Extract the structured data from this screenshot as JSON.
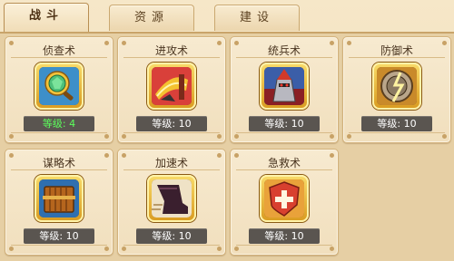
{
  "tabs": [
    {
      "label": "战斗",
      "active": true
    },
    {
      "label": "资源",
      "active": false
    },
    {
      "label": "建设",
      "active": false
    }
  ],
  "skills": [
    {
      "name": "侦查术",
      "level": "等级: 4",
      "icon": "magnifier-icon",
      "highlight": true
    },
    {
      "name": "进攻术",
      "level": "等级: 10",
      "icon": "attack-helmet-icon",
      "highlight": false
    },
    {
      "name": "统兵术",
      "level": "等级: 10",
      "icon": "commander-icon",
      "highlight": false
    },
    {
      "name": "防御术",
      "level": "等级: 10",
      "icon": "shield-icon",
      "highlight": false
    },
    {
      "name": "谋略术",
      "level": "等级: 10",
      "icon": "scroll-book-icon",
      "highlight": false
    },
    {
      "name": "加速术",
      "level": "等级: 10",
      "icon": "speed-boot-icon",
      "highlight": false
    },
    {
      "name": "急救术",
      "level": "等级: 10",
      "icon": "first-aid-icon",
      "highlight": false
    }
  ],
  "colors": {
    "level_normal": "#ffffff",
    "level_highlight": "#5cff5c",
    "background": "#f3e2bf",
    "card_border": "#d3b27c"
  }
}
